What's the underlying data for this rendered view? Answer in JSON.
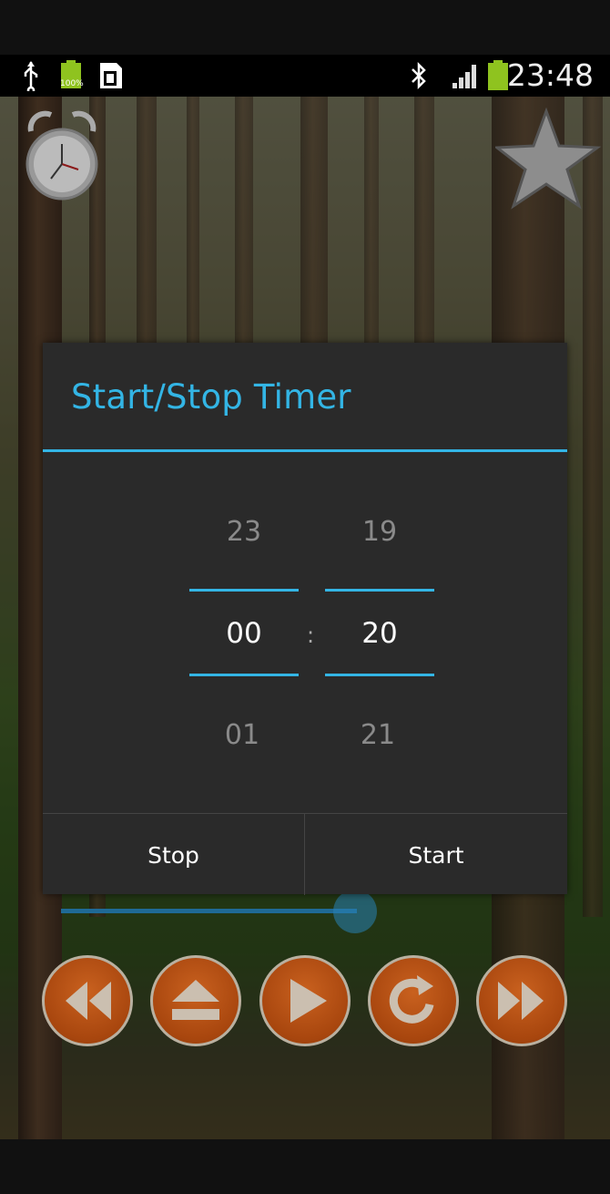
{
  "status_bar": {
    "time": "23:48",
    "battery_small_label": "100%",
    "icons": [
      "usb-icon",
      "battery-full-icon",
      "sd-card-icon",
      "bluetooth-icon",
      "signal-icon",
      "battery-icon"
    ]
  },
  "app": {
    "top_left_icon": "alarm-clock-icon",
    "top_right_icon": "star-icon",
    "controls": [
      "rewind-icon",
      "eject-icon",
      "play-icon",
      "repeat-icon",
      "fast-forward-icon"
    ],
    "progress": 0.99
  },
  "dialog": {
    "title": "Start/Stop Timer",
    "hours": {
      "prev": "23",
      "current": "00",
      "next": "01"
    },
    "separator": ":",
    "minutes": {
      "prev": "19",
      "current": "20",
      "next": "21"
    },
    "buttons": {
      "stop": "Stop",
      "start": "Start"
    }
  },
  "colors": {
    "accent": "#33b5e5",
    "dialog_bg": "#2a2a2a",
    "control_orange": "#a8460e"
  }
}
